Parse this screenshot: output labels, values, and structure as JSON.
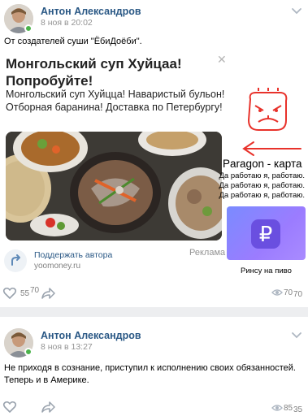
{
  "posts": [
    {
      "author": "Антон Александров",
      "date": "8 ноя в 20:02",
      "text": "От создателей суши \"ЁбиДоёби\".",
      "likes": "55",
      "likes_overlay": "70",
      "views": "70",
      "views_overlay": "70"
    },
    {
      "author": "Антон Александров",
      "date": "8 ноя в 13:27",
      "text_line1": "Не приходя в сознание, приступил к исполнению своих обязанностей.",
      "text_line2": "Теперь и в Америке.",
      "views": "85",
      "views_overlay": "35"
    }
  ],
  "ad": {
    "title_line1": "Монгольский суп Хуйцаа!",
    "title_line2": "Попробуйте!",
    "desc_line1": "Монгольский суп Хуйцца! Наваристый бульон!",
    "desc_line2": "Отборная баранина! Доставка по Петербургу!",
    "close_glyph": "✕",
    "support_label": "Поддержать автора",
    "support_domain": "yoomoney.ru",
    "ad_mark": "Реклама"
  },
  "paragon": {
    "title": "Paragon - карта",
    "lines": [
      "Да работаю я, работаю.",
      "Да работаю я, работаю.",
      "Да работаю я, работаю."
    ],
    "card_glyph": "₽",
    "caption": "Ринсу на пиво"
  },
  "colors": {
    "link": "#2a5885",
    "online": "#4bb34b",
    "annotation_red": "#e8322b",
    "paragon_card": "#8a86ff"
  }
}
